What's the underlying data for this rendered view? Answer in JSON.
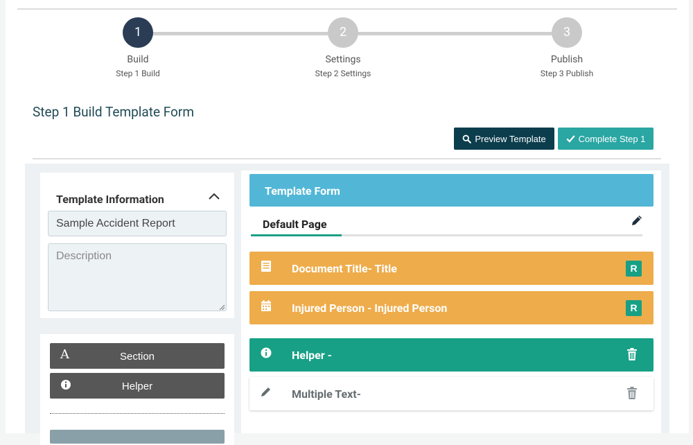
{
  "stepper": {
    "steps": [
      {
        "number": "1",
        "name": "Build",
        "sub": "Step 1 Build",
        "state": "active"
      },
      {
        "number": "2",
        "name": "Settings",
        "sub": "Step 2 Settings",
        "state": "inactive"
      },
      {
        "number": "3",
        "name": "Publish",
        "sub": "Step 3 Publish",
        "state": "inactive"
      }
    ]
  },
  "page_title": "Step 1 Build Template Form",
  "actions": {
    "preview_label": "Preview Template",
    "complete_label": "Complete Step 1"
  },
  "template_info": {
    "title": "Template Information",
    "name_value": "Sample Accident Report",
    "description_placeholder": "Description"
  },
  "tools": {
    "section_label": "Section",
    "helper_label": "Helper"
  },
  "form": {
    "header": "Template Form",
    "tab_label": "Default Page",
    "rows": [
      {
        "label": "Document Title- Title",
        "icon": "document-icon",
        "badge": "R"
      },
      {
        "label": "Injured Person - Injured Person",
        "icon": "calendar-icon",
        "badge": "R"
      },
      {
        "label": "Helper -",
        "icon": "info-icon"
      },
      {
        "label": "Multiple Text-",
        "icon": "pencil-icon"
      }
    ]
  },
  "colors": {
    "step_active": "#2a3d55",
    "step_inactive": "#c9c9c9",
    "preview_button": "#0c3d4d",
    "complete_button": "#2aa6a3",
    "form_header": "#52b7d6",
    "required_row": "#eeac4b",
    "helper_row": "#17a085"
  }
}
